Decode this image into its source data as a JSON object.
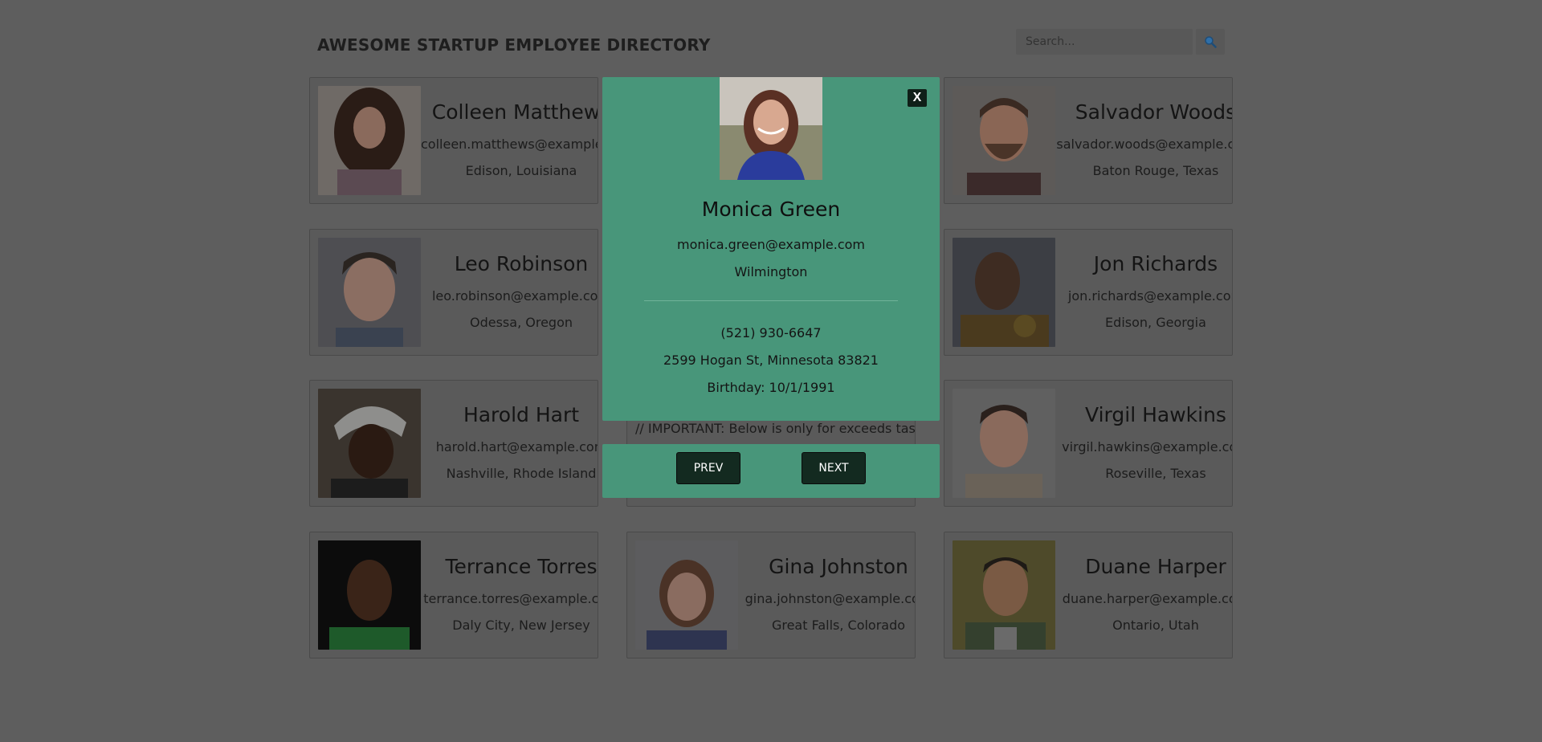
{
  "header": {
    "title": "AWESOME STARTUP EMPLOYEE DIRECTORY",
    "search_placeholder": "Search...",
    "search_icon": "magnifier-icon"
  },
  "cards": [
    {
      "name": "Colleen Matthews",
      "email": "colleen.matthews@example.com",
      "location": "Edison, Louisiana"
    },
    {
      "name": "Salvador Woods",
      "email": "salvador.woods@example.com",
      "location": "Baton Rouge, Texas"
    },
    {
      "name": "Leo Robinson",
      "email": "leo.robinson@example.com",
      "location": "Odessa, Oregon"
    },
    {
      "name": "Jon Richards",
      "email": "jon.richards@example.com",
      "location": "Edison, Georgia"
    },
    {
      "name": "Harold Hart",
      "email": "harold.hart@example.com",
      "location": "Nashville, Rhode Island"
    },
    {
      "name": "Virgil Hawkins",
      "email": "virgil.hawkins@example.com",
      "location": "Roseville, Texas"
    },
    {
      "name": "Terrance Torres",
      "email": "terrance.torres@example.com",
      "location": "Daly City, New Jersey"
    },
    {
      "name": "Gina Johnston",
      "email": "gina.johnston@example.com",
      "location": "Great Falls, Colorado"
    },
    {
      "name": "Duane Harper",
      "email": "duane.harper@example.com",
      "location": "Ontario, Utah"
    }
  ],
  "covered_card_note": "// IMPORTANT: Below is only for exceeds tasks",
  "modal": {
    "close_label": "X",
    "name": "Monica Green",
    "email": "monica.green@example.com",
    "city": "Wilmington",
    "phone": "(521) 930-6647",
    "address": "2599 Hogan St, Minnesota 83821",
    "birthday": "Birthday: 10/1/1991"
  },
  "nav": {
    "prev_label": "PREV",
    "next_label": "NEXT"
  },
  "colors": {
    "overlay_background": "#5e5e5e",
    "modal_background": "#48967a",
    "button_dark": "#132a20"
  }
}
